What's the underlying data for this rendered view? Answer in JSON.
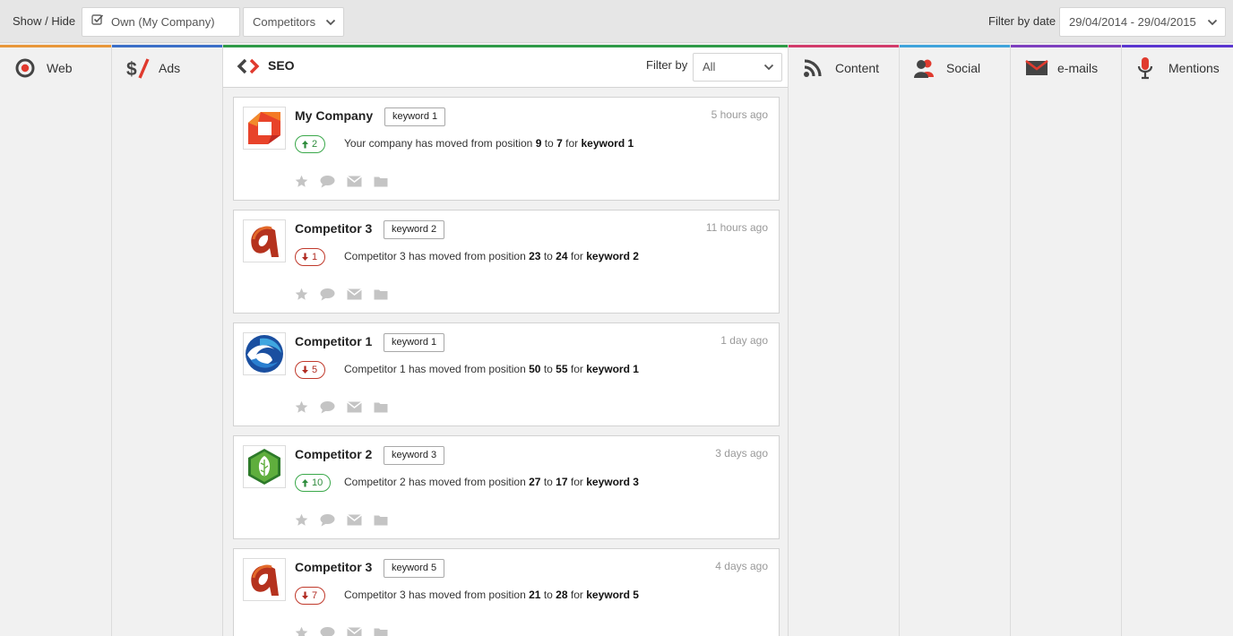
{
  "topbar": {
    "show_hide_label": "Show / Hide",
    "own_label": "Own (My Company)",
    "competitors_label": "Competitors",
    "filter_date_label": "Filter by date",
    "date_range": "29/04/2014 - 29/04/2015"
  },
  "columns": {
    "web": {
      "label": "Web",
      "color": "#e8973a"
    },
    "ads": {
      "label": "Ads",
      "color": "#3b6fc7"
    },
    "seo": {
      "label": "SEO",
      "color": "#2e9a47"
    },
    "content": {
      "label": "Content",
      "color": "#d23b6b"
    },
    "social": {
      "label": "Social",
      "color": "#3fa3db"
    },
    "emails": {
      "label": "e-mails",
      "color": "#7d3fbf"
    },
    "mentions": {
      "label": "Mentions",
      "color": "#5a35d0"
    }
  },
  "seo": {
    "filter_label": "Filter by",
    "filter_value": "All",
    "cards": [
      {
        "name": "My Company",
        "keyword": "keyword 1",
        "time": "5 hours ago",
        "dir": "up",
        "delta": "2",
        "msg_pre": "Your company has moved from position",
        "from": "9",
        "to_word": "to",
        "to": "7",
        "for_word": "for",
        "kw_bold": "keyword 1",
        "logo": "mycompany-logo"
      },
      {
        "name": "Competitor 3",
        "keyword": "keyword 2",
        "time": "11 hours ago",
        "dir": "down",
        "delta": "1",
        "msg_pre": "Competitor 3 has moved from position",
        "from": "23",
        "to_word": "to",
        "to": "24",
        "for_word": "for",
        "kw_bold": "keyword 2",
        "logo": "competitor3-logo"
      },
      {
        "name": "Competitor 1",
        "keyword": "keyword 1",
        "time": "1 day ago",
        "dir": "down",
        "delta": "5",
        "msg_pre": "Competitor 1 has moved from position",
        "from": "50",
        "to_word": "to",
        "to": "55",
        "for_word": "for",
        "kw_bold": "keyword 1",
        "logo": "competitor1-logo"
      },
      {
        "name": "Competitor 2",
        "keyword": "keyword 3",
        "time": "3 days ago",
        "dir": "up",
        "delta": "10",
        "msg_pre": "Competitor 2 has moved from position",
        "from": "27",
        "to_word": "to",
        "to": "17",
        "for_word": "for",
        "kw_bold": "keyword 3",
        "logo": "competitor2-logo"
      },
      {
        "name": "Competitor 3",
        "keyword": "keyword 5",
        "time": "4 days ago",
        "dir": "down",
        "delta": "7",
        "msg_pre": "Competitor 3 has moved from position",
        "from": "21",
        "to_word": "to",
        "to": "28",
        "for_word": "for",
        "kw_bold": "keyword 5",
        "logo": "competitor3-logo"
      }
    ]
  }
}
